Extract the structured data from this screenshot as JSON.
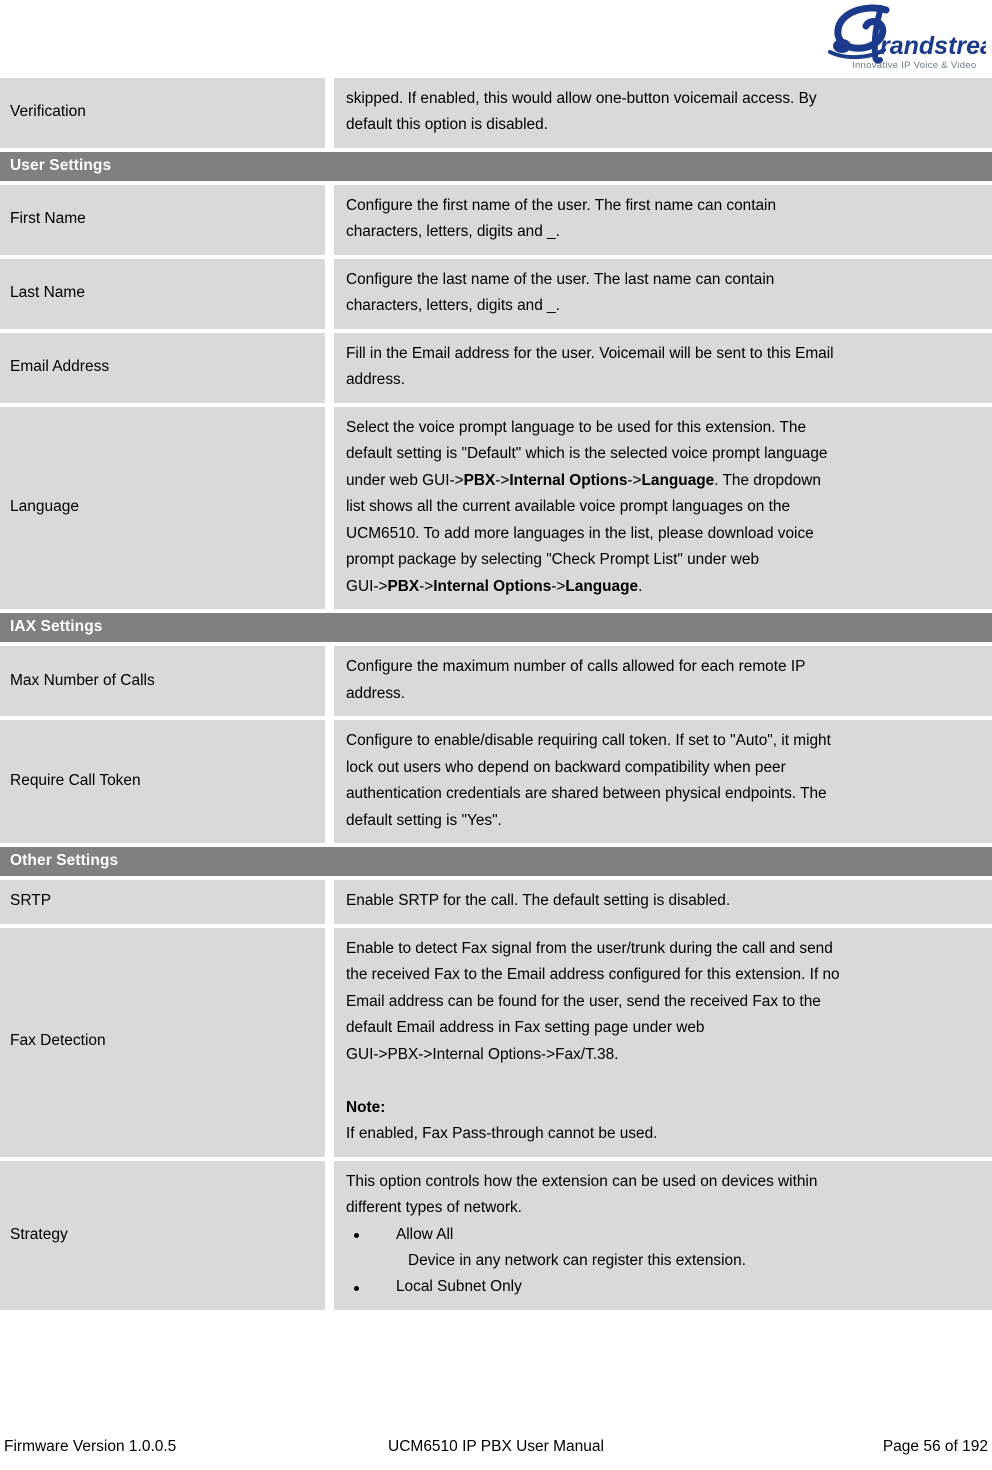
{
  "header": {
    "logo_name": "Grandstream",
    "logo_text": "randstream",
    "logo_tagline": "Innovative IP Voice & Video",
    "logo_color": "#1b3a8c",
    "tagline_color": "#6b7a8f"
  },
  "table": {
    "rows": [
      {
        "type": "data",
        "label": "Verification",
        "lines": [
          "skipped. If enabled, this would allow one-button voicemail access. By",
          "default this option is disabled."
        ]
      },
      {
        "type": "section",
        "label": "User Settings"
      },
      {
        "type": "data",
        "label": "First Name",
        "lines": [
          "Configure the first name of the user. The first name can contain",
          "characters, letters, digits and _."
        ]
      },
      {
        "type": "data",
        "label": "Last Name",
        "lines": [
          "Configure the last name of the user. The last name can contain",
          "characters, letters, digits and _."
        ]
      },
      {
        "type": "data",
        "label": "Email Address",
        "lines": [
          "Fill in the Email address for the user. Voicemail will be sent to this Email",
          "address."
        ]
      },
      {
        "type": "data-rich",
        "label": "Language",
        "rich_lines": [
          [
            {
              "t": "Select the voice prompt language to be used for this extension. The",
              "b": false
            }
          ],
          [
            {
              "t": "default setting is \"Default\" which is the selected voice prompt language",
              "b": false
            }
          ],
          [
            {
              "t": "under web GUI->",
              "b": false
            },
            {
              "t": "PBX",
              "b": true
            },
            {
              "t": "->",
              "b": false
            },
            {
              "t": "Internal Options",
              "b": true
            },
            {
              "t": "->",
              "b": false
            },
            {
              "t": "Language",
              "b": true
            },
            {
              "t": ". The dropdown",
              "b": false
            }
          ],
          [
            {
              "t": "list shows all the current available voice prompt languages on the",
              "b": false
            }
          ],
          [
            {
              "t": "UCM6510. To add more languages in the list, please download voice",
              "b": false
            }
          ],
          [
            {
              "t": "prompt package by selecting \"Check Prompt List\" under web",
              "b": false
            }
          ],
          [
            {
              "t": "GUI->",
              "b": false
            },
            {
              "t": "PBX",
              "b": true
            },
            {
              "t": "->",
              "b": false
            },
            {
              "t": "Internal Options",
              "b": true
            },
            {
              "t": "->",
              "b": false
            },
            {
              "t": "Language",
              "b": true
            },
            {
              "t": ".",
              "b": false
            }
          ]
        ]
      },
      {
        "type": "section",
        "label": "IAX Settings"
      },
      {
        "type": "data",
        "label": "Max Number of Calls",
        "lines": [
          "Configure the maximum number of calls allowed for each remote IP",
          "address."
        ]
      },
      {
        "type": "data",
        "label": "Require Call Token",
        "lines": [
          "Configure to enable/disable requiring call token. If set to \"Auto\", it might",
          "lock out users who depend on backward compatibility when peer",
          "authentication credentials are shared between physical endpoints. The",
          "default setting is \"Yes\"."
        ]
      },
      {
        "type": "section",
        "label": "Other Settings"
      },
      {
        "type": "data",
        "label": "SRTP",
        "lines": [
          "Enable SRTP for the call. The default setting is disabled."
        ]
      },
      {
        "type": "data-note",
        "label": "Fax Detection",
        "lines": [
          "Enable to detect Fax signal from the user/trunk during the call and send",
          "the received Fax to the Email address configured for this extension. If no",
          "Email address can be found for the user, send the received Fax to the",
          "default Email address in Fax setting page under web",
          "GUI->PBX->Internal Options->Fax/T.38."
        ],
        "note_title": "Note:",
        "note_body": "If enabled, Fax Pass-through cannot be used."
      },
      {
        "type": "data-bullets",
        "label": "Strategy",
        "lines": [
          "This option controls how the extension can be used on devices within",
          "different types of network."
        ],
        "bullets": [
          {
            "label": "Allow All",
            "sub": "Device in any network can register this extension."
          },
          {
            "label": "Local Subnet Only",
            "sub": ""
          }
        ]
      }
    ]
  },
  "footer": {
    "left": "Firmware Version 1.0.0.5",
    "center": "UCM6510 IP PBX User Manual",
    "right": "Page 56 of 192"
  }
}
